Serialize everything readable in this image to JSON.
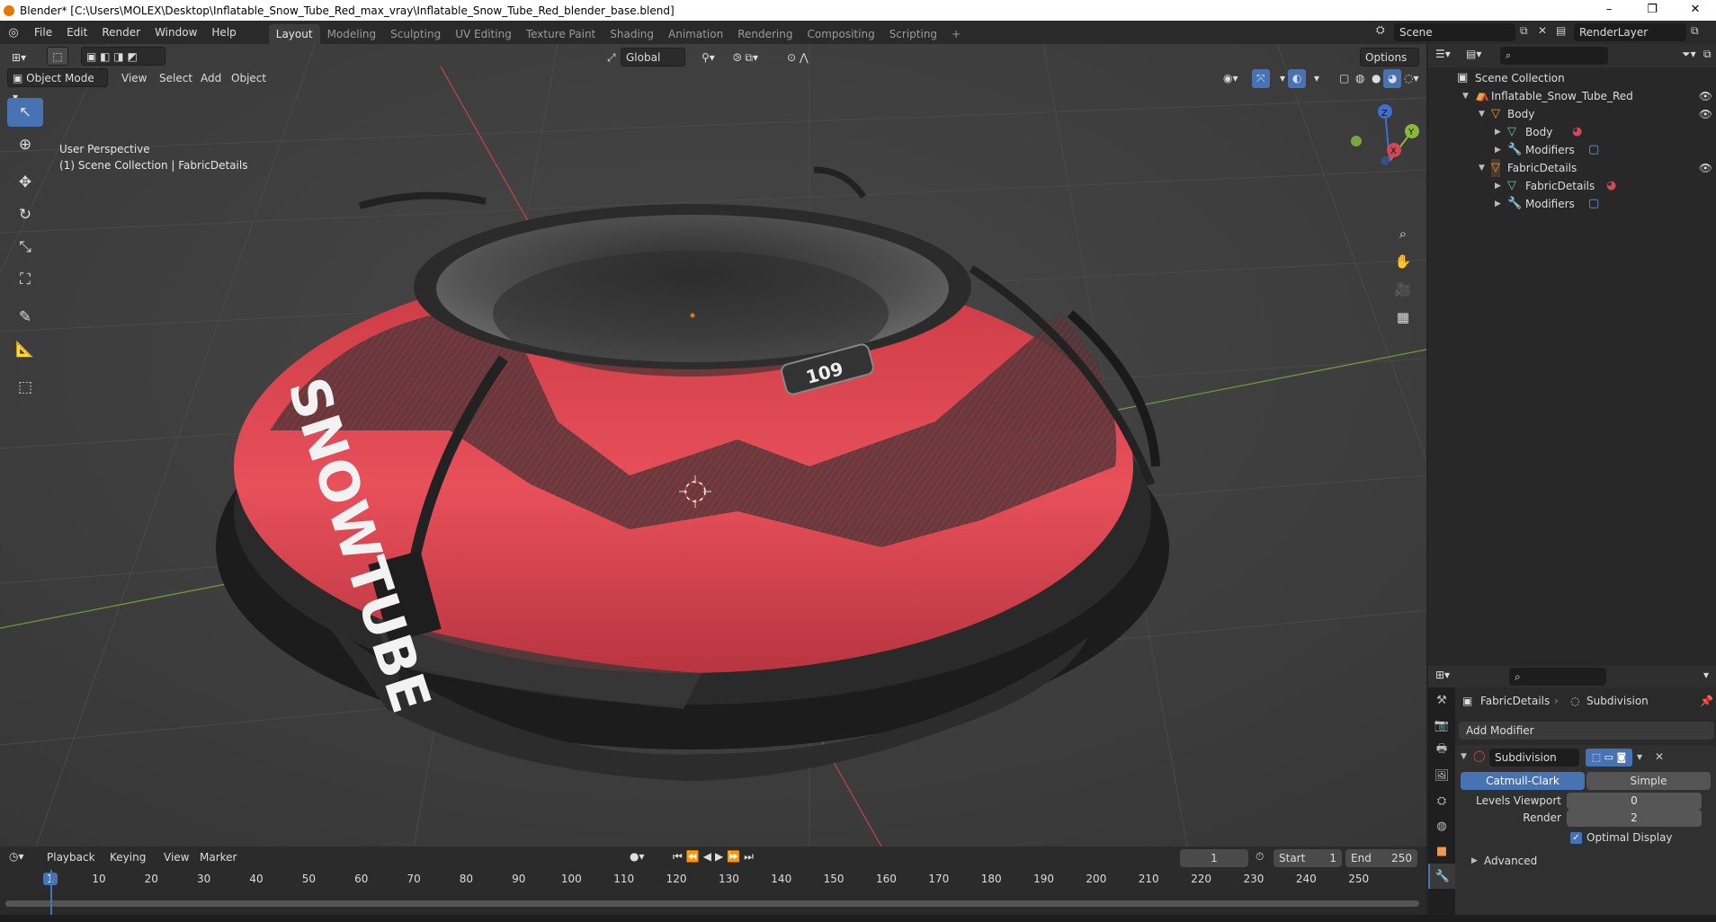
{
  "window": {
    "title": "Blender* [C:\\Users\\MOLEX\\Desktop\\Inflatable_Snow_Tube_Red_max_vray\\Inflatable_Snow_Tube_Red_blender_base.blend]",
    "minimize": "–",
    "maximize": "❐",
    "close": "✕"
  },
  "menu": {
    "file": "File",
    "edit": "Edit",
    "render": "Render",
    "window": "Window",
    "help": "Help"
  },
  "workspaces": [
    "Layout",
    "Modeling",
    "Sculpting",
    "UV Editing",
    "Texture Paint",
    "Shading",
    "Animation",
    "Rendering",
    "Compositing",
    "Scripting",
    "+"
  ],
  "scene": {
    "name": "Scene",
    "view_layer": "RenderLayer"
  },
  "viewport": {
    "orientation": "Global",
    "options": "Options",
    "mode": "Object Mode",
    "menus": {
      "view": "View",
      "select": "Select",
      "add": "Add",
      "object": "Object"
    },
    "perspective": "User Perspective",
    "collection_info": "(1) Scene Collection | FabricDetails",
    "gizmo": {
      "z": "Z",
      "y": "Y",
      "x": "X"
    },
    "logo_text": "SNOWTUBE",
    "badge_text": "109"
  },
  "outliner": {
    "rows": [
      {
        "label": "Scene Collection",
        "icon": "collection-icon"
      },
      {
        "label": "Inflatable_Snow_Tube_Red",
        "icon": "object-icon"
      },
      {
        "label": "Body",
        "icon": "mesh-object-icon"
      },
      {
        "label": "Body",
        "icon": "mesh-data-icon"
      },
      {
        "label": "Modifiers",
        "icon": "wrench-icon"
      },
      {
        "label": "FabricDetails",
        "icon": "mesh-object-icon"
      },
      {
        "label": "FabricDetails",
        "icon": "mesh-data-icon"
      },
      {
        "label": "Modifiers",
        "icon": "wrench-icon"
      }
    ]
  },
  "properties": {
    "object_name": "FabricDetails",
    "modifier_breadcrumb": "Subdivision",
    "add_modifier": "Add Modifier",
    "modifier_name": "Subdivision",
    "types": [
      "Catmull-Clark",
      "Simple"
    ],
    "levels_viewport_label": "Levels Viewport",
    "levels_viewport": "0",
    "render_label": "Render",
    "render": "2",
    "optimal_display": "Optimal Display",
    "advanced": "Advanced"
  },
  "timeline": {
    "playback": "Playback",
    "keying": "Keying",
    "view": "View",
    "marker": "Marker",
    "current_frame": "1",
    "start_label": "Start",
    "start": "1",
    "end_label": "End",
    "end": "250",
    "ticks": [
      "1",
      "10",
      "20",
      "30",
      "40",
      "50",
      "60",
      "70",
      "80",
      "90",
      "100",
      "110",
      "120",
      "130",
      "140",
      "150",
      "160",
      "170",
      "180",
      "190",
      "200",
      "210",
      "220",
      "230",
      "240",
      "250"
    ]
  },
  "colors": {
    "accent": "#4772b3",
    "tube_red": "#e0434e",
    "grid": "#444444",
    "x_axis": "#c8454f",
    "y_axis": "#7aa33a"
  }
}
